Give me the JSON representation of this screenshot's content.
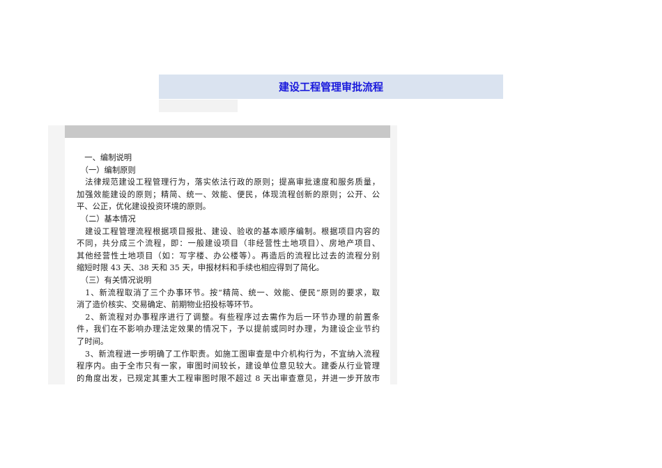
{
  "header": {
    "title": "建设工程管理审批流程"
  },
  "document": {
    "lines": [
      {
        "text": "　一、编制说明",
        "full": false
      },
      {
        "text": "　（一）编制原则",
        "full": false
      },
      {
        "text": "　法律规范建设工程管理行为，落实依法行政的原则；提高审批速度和服务质量，",
        "full": true
      },
      {
        "text": "加强效能建设的原则；精简、统一、效能、便民，体现流程创新的原则；公开、公",
        "full": true
      },
      {
        "text": "平、公正，优化建设投资环境的原则。",
        "full": false
      },
      {
        "text": "　（二）基本情况",
        "full": false
      },
      {
        "text": "　建设工程管理流程根据项目报批、建设、验收的基本顺序编制。根据项目内容的",
        "full": true
      },
      {
        "text": "不同，共分成三个流程，即：一般建设项目（非经营性土地项目）、房地产项目、",
        "full": true
      },
      {
        "text": "其他经营性土地项目（如：写字楼、办公楼等）。再造后的流程比过去的流程分别",
        "full": true
      },
      {
        "text": "缩短时限 43 天、38 天和 35 天，申报材料和手续也相应得到了简化。",
        "full": false
      },
      {
        "text": "　（三）有关情况说明",
        "full": false
      },
      {
        "text": "　1、新流程取消了三个办事环节。按“精简、统一、效能、便民”原则的要求，取",
        "full": true
      },
      {
        "text": "消了造价核实、交易确定、前期物业招投标等环节。",
        "full": false
      },
      {
        "text": "　2、新流程对办事程序进行了调整。有些程序过去需作为后一环节办理的前置条",
        "full": true
      },
      {
        "text": "件，我们在不影响办理法定效果的情况下，予以提前或同时办理，为建设企业节约",
        "full": true
      },
      {
        "text": "了时间。",
        "full": false
      },
      {
        "text": "　3、新流程进一步明确了工作职责。如施工图审查是中介机构行为，不宜纳入流程",
        "full": true
      },
      {
        "text": "程序内。由于全市只有一家，审图时间较长，建设单位意见较大。建委从行业管理",
        "full": true
      },
      {
        "text": "的角度出发，已规定其重大工程审图时限不超过 8 天出审查意见，并进一步开放市",
        "full": true
      }
    ]
  }
}
